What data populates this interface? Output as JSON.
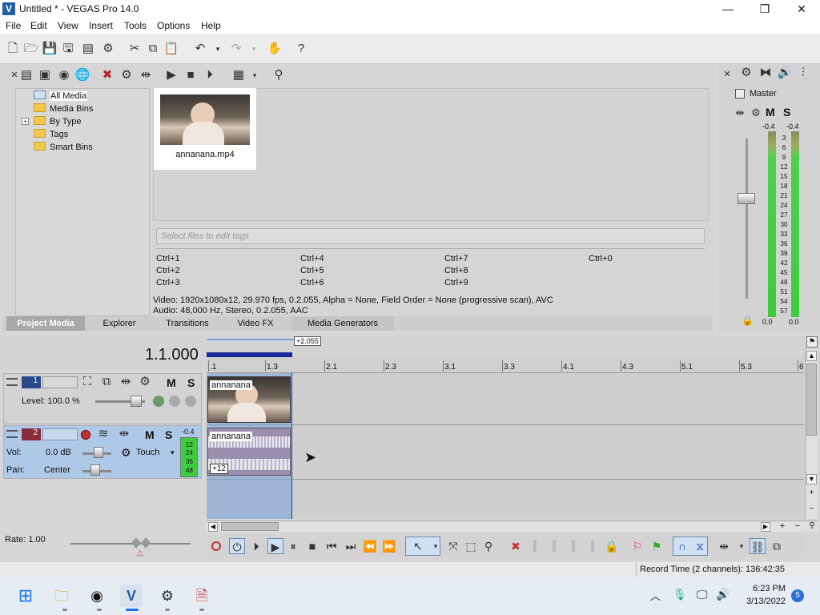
{
  "window": {
    "title": "Untitled * - VEGAS Pro 14.0",
    "app_icon_glyph": "V",
    "minimize": "—",
    "maximize": "❐",
    "close": "✕"
  },
  "menu": [
    "File",
    "Edit",
    "View",
    "Insert",
    "Tools",
    "Options",
    "Help"
  ],
  "media_tree": {
    "items": [
      {
        "label": "All Media",
        "selected": true,
        "icon": "media-icon"
      },
      {
        "label": "Media Bins",
        "icon": "folder-icon"
      },
      {
        "label": "By Type",
        "icon": "folder-icon",
        "expander": "+"
      },
      {
        "label": "Tags",
        "icon": "folder-icon"
      },
      {
        "label": "Smart Bins",
        "icon": "folder-icon"
      }
    ]
  },
  "media": {
    "thumbnail_label": "annanana.mp4",
    "tags_placeholder": "Select files to edit tags",
    "shortcuts": [
      [
        "Ctrl+1",
        "Ctrl+4",
        "Ctrl+7",
        "Ctrl+0"
      ],
      [
        "Ctrl+2",
        "Ctrl+5",
        "Ctrl+8",
        ""
      ],
      [
        "Ctrl+3",
        "Ctrl+6",
        "Ctrl+9",
        ""
      ]
    ],
    "video_info": "Video: 1920x1080x12, 29.970 fps, 0.2.055, Alpha = None, Field Order = None (progressive scan), AVC",
    "audio_info": "Audio: 48,000 Hz, Stereo, 0.2.055, AAC"
  },
  "tabs": [
    "Project Media",
    "Explorer",
    "Transitions",
    "Video FX",
    "Media Generators"
  ],
  "mixer": {
    "label": "Master",
    "m_label": "M",
    "s_label": "S",
    "peak_left": "-0.4",
    "peak_right": "-0.4",
    "scale": [
      "3",
      "6",
      "9",
      "12",
      "15",
      "18",
      "21",
      "24",
      "27",
      "30",
      "33",
      "36",
      "39",
      "42",
      "45",
      "48",
      "51",
      "54",
      "57"
    ],
    "level_left": "0.0",
    "level_right": "0.0"
  },
  "timeline": {
    "position": "1.1.000",
    "loop_duration": "+2.055",
    "ruler_labels": [
      ".1",
      "1.3",
      "2.1",
      "2.3",
      "3.1",
      "3.3",
      "4.1",
      "4.3",
      "5.1",
      "5.3",
      "6"
    ]
  },
  "video_track": {
    "number": "1",
    "level_label": "Level: 100.0 %",
    "clip_name": "annanana",
    "m_label": "M",
    "s_label": "S"
  },
  "audio_track": {
    "number": "2",
    "vol_label": "Vol:",
    "vol_value": "0.0 dB",
    "pan_label": "Pan:",
    "pan_value": "Center",
    "automation": "Touch",
    "clip_name": "annanana",
    "clip_gain": "+12",
    "peak": "-0.4",
    "meter_labels": [
      "12",
      "24",
      "36",
      "48"
    ],
    "m_label": "M",
    "s_label": "S"
  },
  "transport": {
    "rate_label": "Rate: 1.00"
  },
  "status": {
    "record_time": "Record Time (2 channels): 136:42:35"
  },
  "taskbar": {
    "time": "6:23 PM",
    "date": "3/13/2022",
    "notification_count": "5"
  },
  "colors": {
    "selection": "#7aa0dc",
    "meter_green": "#3ccc3c",
    "track_selected": "#aec8e8",
    "audio_track_number_bg": "#8a2a3a",
    "video_track_number_bg": "#2a4a8a"
  }
}
